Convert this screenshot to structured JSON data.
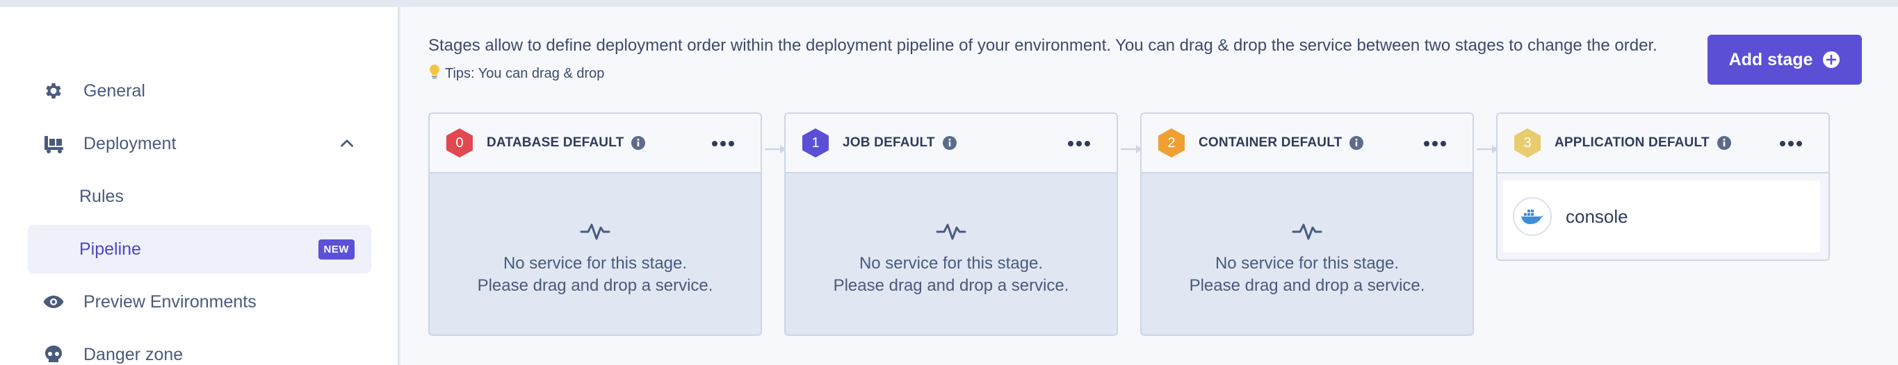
{
  "sidebar": {
    "items": [
      {
        "label": "General",
        "icon": "gear-icon"
      },
      {
        "label": "Deployment",
        "icon": "deployment-icon"
      },
      {
        "label": "Rules"
      },
      {
        "label": "Pipeline",
        "badge": "NEW"
      },
      {
        "label": "Preview Environments",
        "icon": "eye-icon"
      },
      {
        "label": "Danger zone",
        "icon": "skull-icon"
      }
    ]
  },
  "main": {
    "description": "Stages allow to define deployment order within the deployment pipeline of your environment. You can drag & drop the service between two stages to change the order.",
    "tips": "Tips: You can drag & drop",
    "add_stage_label": "Add stage"
  },
  "stages": [
    {
      "index": "0",
      "title": "DATABASE DEFAULT",
      "color": "#e2484f",
      "empty_line1": "No service for this stage.",
      "empty_line2": "Please drag and drop a service."
    },
    {
      "index": "1",
      "title": "JOB DEFAULT",
      "color": "#5b4fd6",
      "empty_line1": "No service for this stage.",
      "empty_line2": "Please drag and drop a service."
    },
    {
      "index": "2",
      "title": "CONTAINER DEFAULT",
      "color": "#f0a030",
      "empty_line1": "No service for this stage.",
      "empty_line2": "Please drag and drop a service."
    },
    {
      "index": "3",
      "title": "APPLICATION DEFAULT",
      "color": "#e8cc6e",
      "service": {
        "name": "console",
        "icon": "docker-icon"
      }
    }
  ],
  "colors": {
    "accent": "#5b4fd6",
    "text": "#3d4a6a",
    "border": "#cdd6e6"
  }
}
